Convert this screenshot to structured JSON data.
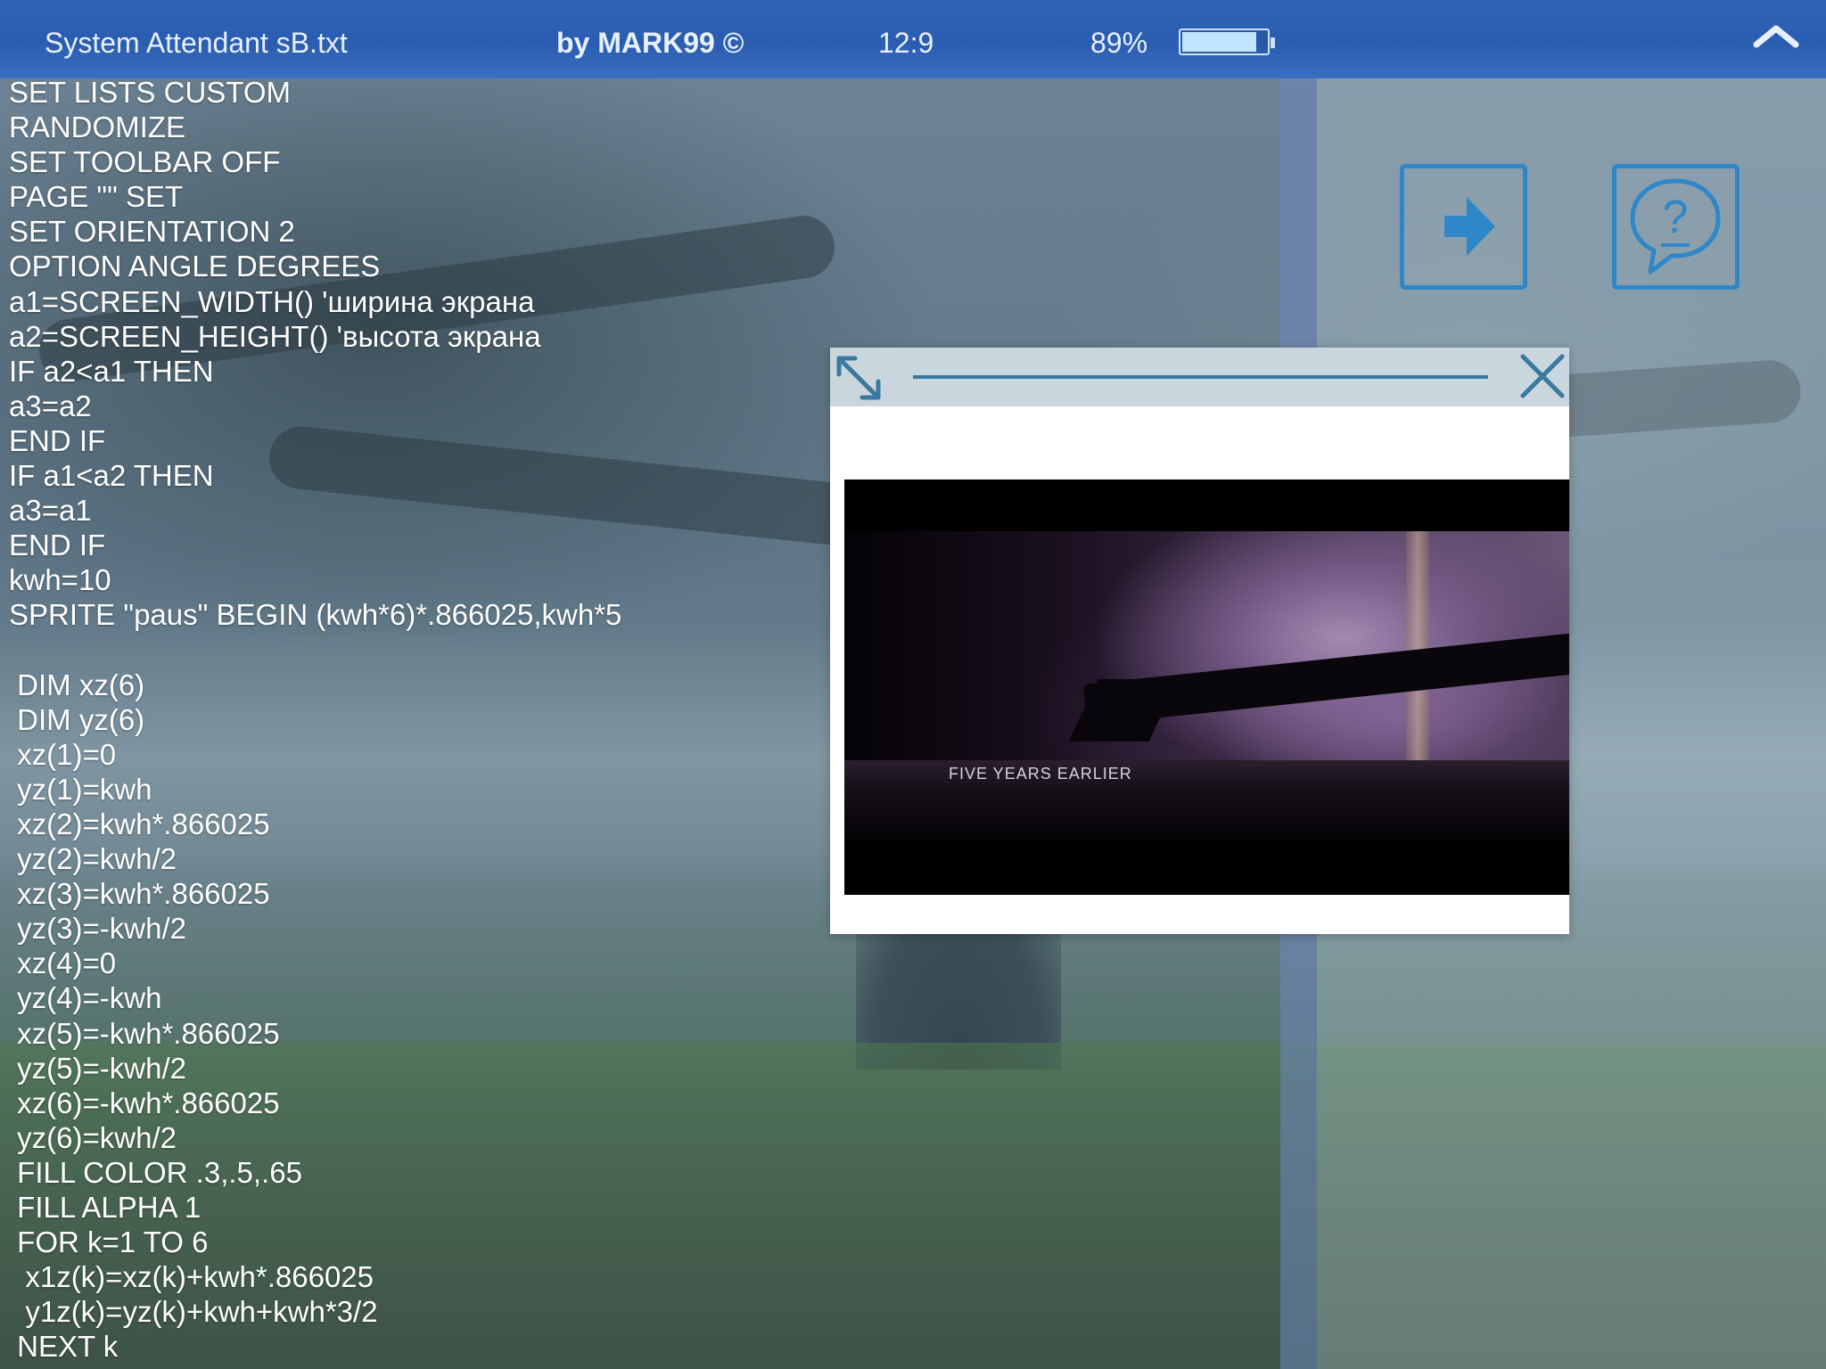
{
  "topbar": {
    "file_name": "System Attendant sB.txt",
    "author": "by MARK99 ©",
    "time": "12:9",
    "battery_text": "89%",
    "battery_level": 0.89
  },
  "code_lines": [
    "SET LISTS CUSTOM",
    "RANDOMIZE",
    "SET TOOLBAR OFF",
    "PAGE \"\" SET",
    "SET ORIENTATION 2",
    "OPTION ANGLE DEGREES",
    "a1=SCREEN_WIDTH() 'ширина экрана",
    "a2=SCREEN_HEIGHT() 'высота экрана",
    "IF a2<a1 THEN",
    "a3=a2",
    "END IF",
    "IF a1<a2 THEN",
    "a3=a1",
    "END IF",
    "kwh=10",
    "SPRITE \"paus\" BEGIN (kwh*6)*.866025,kwh*5",
    "",
    " DIM xz(6)",
    " DIM yz(6)",
    " xz(1)=0",
    " yz(1)=kwh",
    " xz(2)=kwh*.866025",
    " yz(2)=kwh/2",
    " xz(3)=kwh*.866025",
    " yz(3)=-kwh/2",
    " xz(4)=0",
    " yz(4)=-kwh",
    " xz(5)=-kwh*.866025",
    " yz(5)=-kwh/2",
    " xz(6)=-kwh*.866025",
    " yz(6)=kwh/2",
    " FILL COLOR .3,.5,.65",
    " FILL ALPHA 1",
    " FOR k=1 TO 6",
    "  x1z(k)=xz(k)+kwh*.866025",
    "  y1z(k)=yz(k)+kwh+kwh*3/2",
    " NEXT k"
  ],
  "buttons": {
    "next_icon": "arrow-right-icon",
    "help_icon": "question-bubble-icon"
  },
  "video_popup": {
    "caption": "FIVE YEARS EARLIER",
    "expand_icon": "expand-diagonal-icon",
    "close_icon": "close-icon"
  },
  "colors": {
    "topbar": "#2f64b8",
    "accent": "#2d87c8",
    "code_text": "#ffffff"
  }
}
